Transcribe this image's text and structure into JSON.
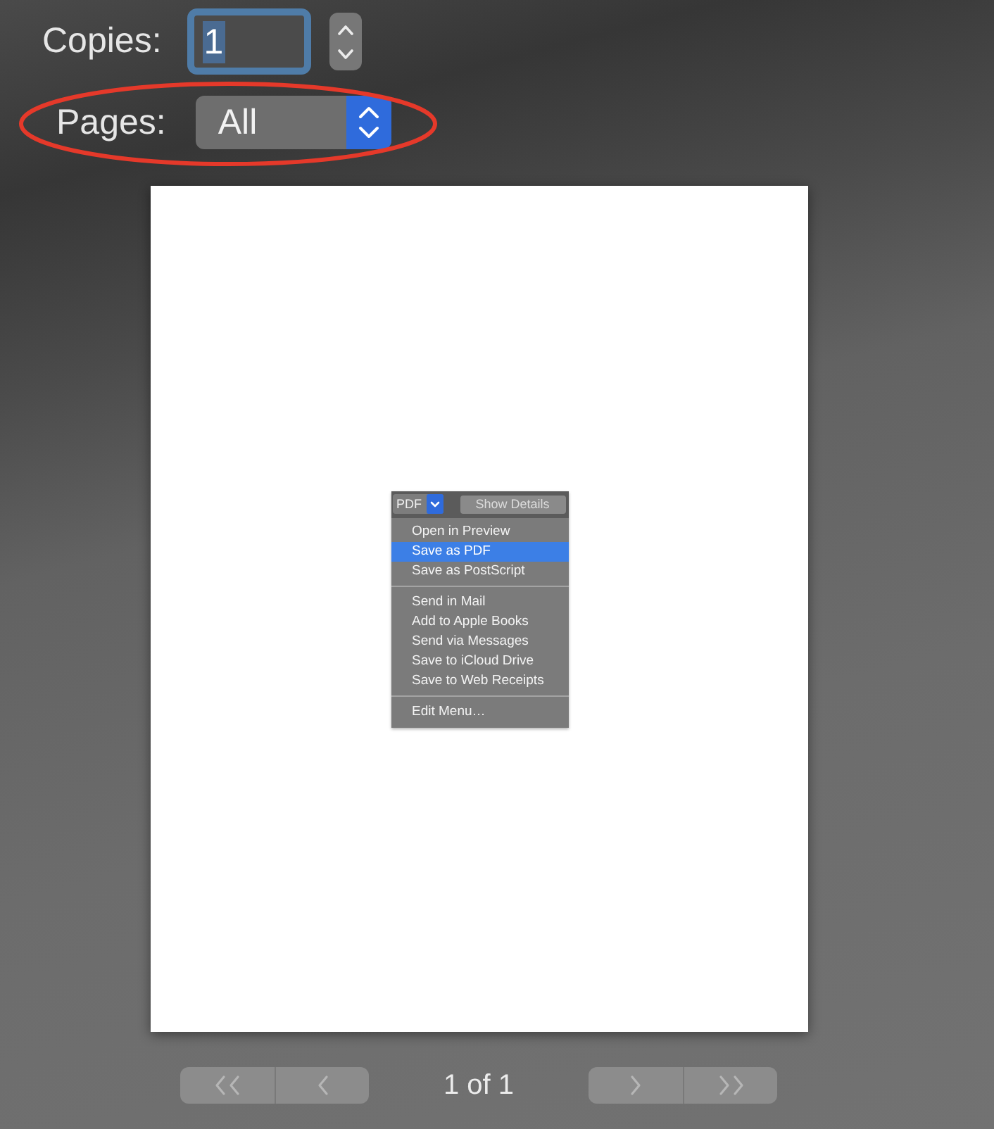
{
  "copies": {
    "label": "Copies:",
    "value": "1",
    "focused": true
  },
  "pages": {
    "label": "Pages:",
    "value": "All",
    "circled": true
  },
  "preview": {
    "pdf_button": "PDF",
    "details_button": "Show Details",
    "menu_groups": [
      [
        {
          "label": "Open in Preview",
          "selected": false
        },
        {
          "label": "Save as PDF",
          "selected": true
        },
        {
          "label": "Save as PostScript",
          "selected": false
        }
      ],
      [
        {
          "label": "Send in Mail",
          "selected": false
        },
        {
          "label": "Add to Apple Books",
          "selected": false
        },
        {
          "label": "Send via Messages",
          "selected": false
        },
        {
          "label": "Save to iCloud Drive",
          "selected": false
        },
        {
          "label": "Save to Web Receipts",
          "selected": false
        }
      ],
      [
        {
          "label": "Edit Menu…",
          "selected": false
        }
      ]
    ]
  },
  "pager": {
    "page_label": "1 of 1"
  }
}
